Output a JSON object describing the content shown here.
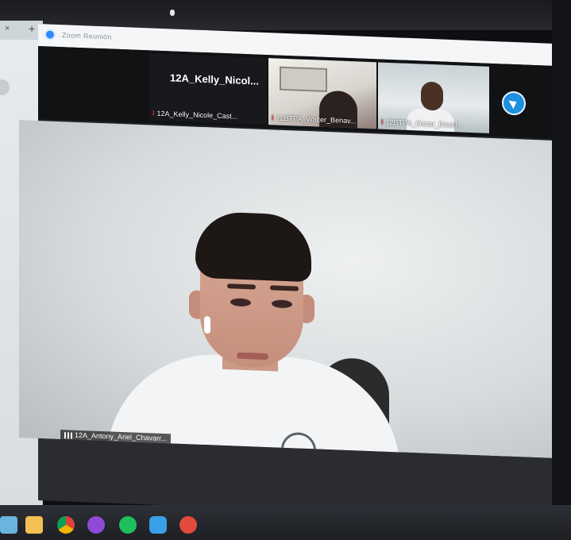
{
  "window": {
    "title": "Zoom Reunión"
  },
  "participant_strip": {
    "center_name": "12A_Kelly_Nicol...",
    "tiles": [
      {
        "label": "12A_Kelly_Nicole_Cast...",
        "mic": "muted"
      },
      {
        "label": "12BTPA_Walter_Benav...",
        "mic": "muted"
      },
      {
        "label": "12BTPA_Oscar_David...",
        "mic": "muted"
      }
    ],
    "next_icon": "chevron-right-icon"
  },
  "main_speaker": {
    "label": "12A_Antony_Ariel_Chavarr..."
  },
  "browser": {
    "tab_close": "×",
    "tab_add": "+"
  },
  "taskbar": {
    "icons": [
      "store-icon",
      "folder-icon",
      "chrome-icon",
      "purple-app-icon",
      "whatsapp-icon",
      "zoom-icon",
      "red-app-icon"
    ]
  },
  "colors": {
    "zoom_blue": "#2d8cff",
    "muted_red": "#ff3b3b"
  }
}
